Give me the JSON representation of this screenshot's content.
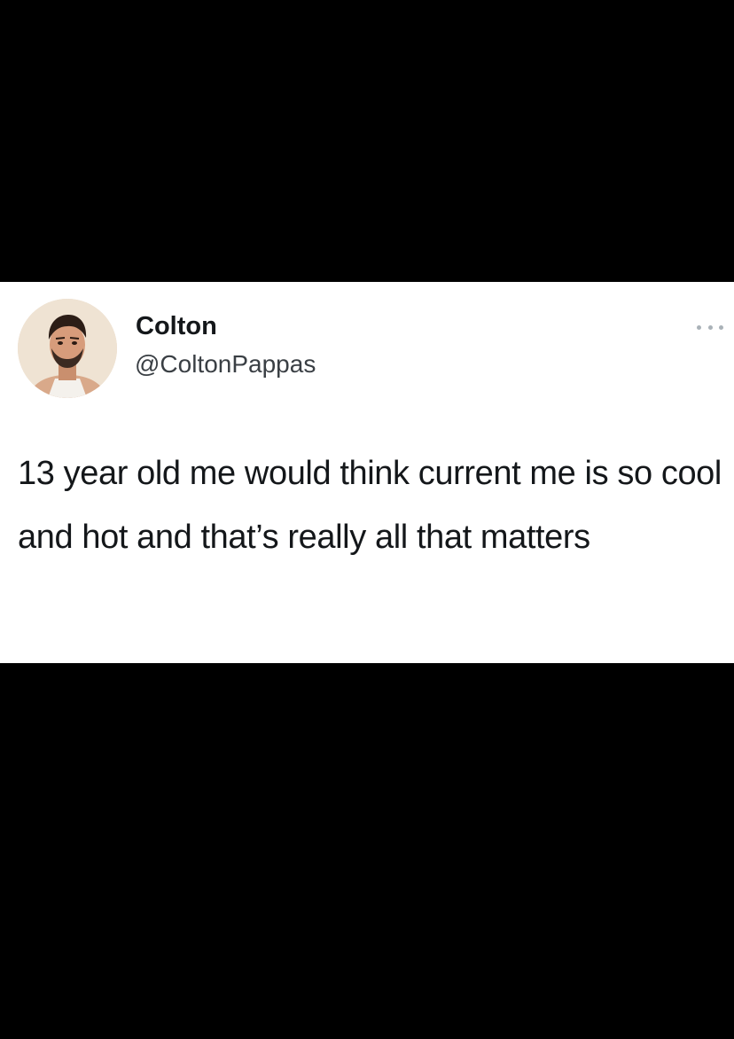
{
  "tweet": {
    "author": {
      "display_name": "Colton",
      "handle": "@ColtonPappas",
      "avatar_icon": "profile-photo"
    },
    "menu_icon": "more-options-icon",
    "text": "13 year old me would think current me is so cool and hot and that’s really all that matters"
  },
  "colors": {
    "background": "#000000",
    "card": "#ffffff",
    "text": "#14171a",
    "secondary_text": "#3a3f44"
  }
}
